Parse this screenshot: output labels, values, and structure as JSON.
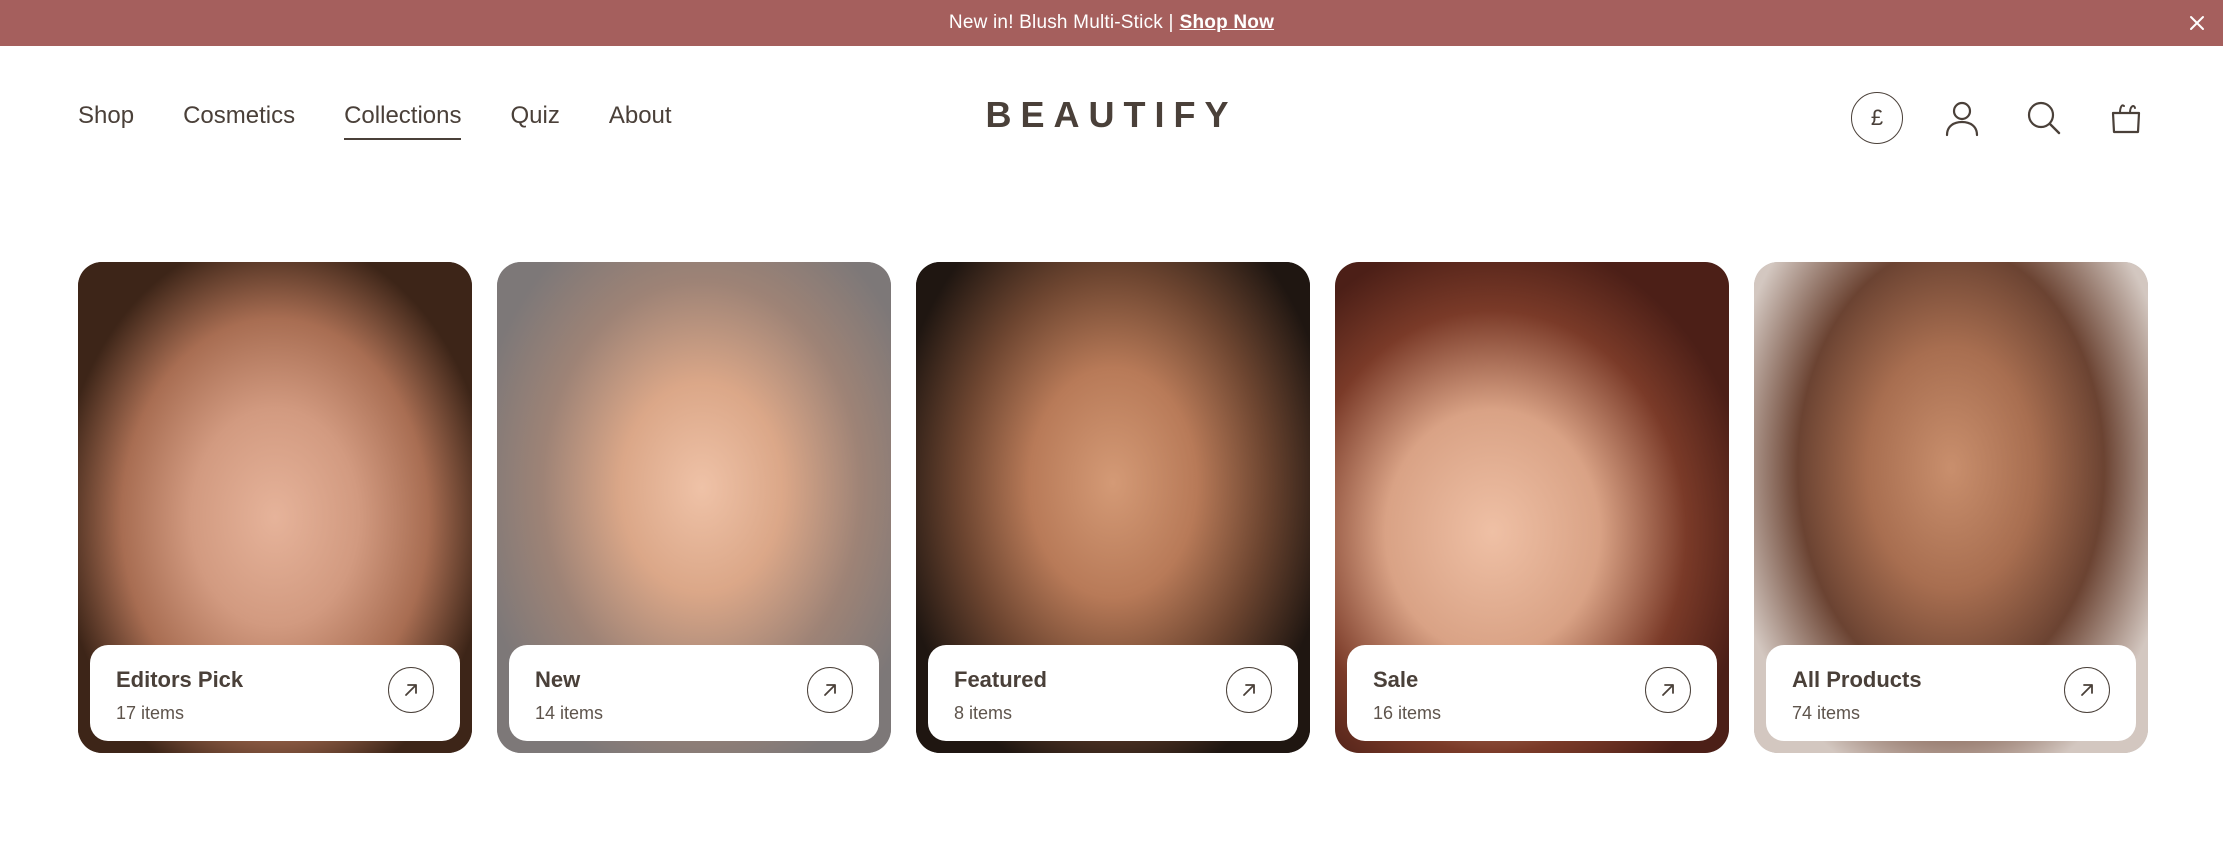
{
  "announcement": {
    "text": "New in! Blush Multi-Stick |",
    "link": "Shop Now"
  },
  "nav": {
    "items": [
      {
        "label": "Shop"
      },
      {
        "label": "Cosmetics"
      },
      {
        "label": "Collections"
      },
      {
        "label": "Quiz"
      },
      {
        "label": "About"
      }
    ],
    "active": "Collections"
  },
  "brand": {
    "logo": "BEAUTIFY"
  },
  "header_icons": {
    "currency": "£",
    "account": "user-icon",
    "search": "search-icon",
    "bag": "bag-icon"
  },
  "collections": [
    {
      "title": "Editors Pick",
      "count": "17 items"
    },
    {
      "title": "New",
      "count": "14 items"
    },
    {
      "title": "Featured",
      "count": "8 items"
    },
    {
      "title": "Sale",
      "count": "16 items"
    },
    {
      "title": "All Products",
      "count": "74 items"
    }
  ],
  "colors": {
    "announcement_bg": "#a55f5d",
    "text": "#4a4039"
  }
}
